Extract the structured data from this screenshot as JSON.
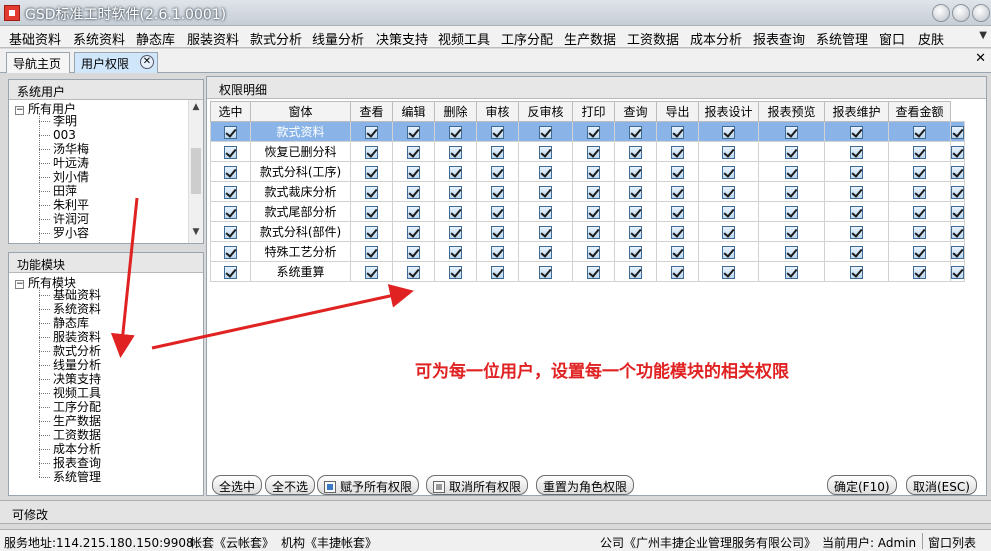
{
  "window": {
    "title": "GSD标准工时软件(2.6.1.0001)",
    "accent_color": "#e02222",
    "selection_color": "#8ab4e8"
  },
  "menu": [
    {
      "label": "基础资料"
    },
    {
      "label": "系统资料"
    },
    {
      "label": "静态库"
    },
    {
      "label": "服装资料"
    },
    {
      "label": "款式分析"
    },
    {
      "label": "线量分析"
    },
    {
      "label": "决策支持"
    },
    {
      "label": "视频工具"
    },
    {
      "label": "工序分配"
    },
    {
      "label": "生产数据"
    },
    {
      "label": "工资数据"
    },
    {
      "label": "成本分析"
    },
    {
      "label": "报表查询"
    },
    {
      "label": "系统管理"
    },
    {
      "label": "窗口"
    },
    {
      "label": "皮肤"
    }
  ],
  "tabs": {
    "home_label": "导航主页",
    "active_label": "用户权限"
  },
  "users_panel": {
    "header": "系统用户",
    "root": "所有用户",
    "users": [
      "李明",
      "003",
      "汤华梅",
      "叶远涛",
      "刘小倩",
      "田萍",
      "朱利平",
      "许润河",
      "罗小容"
    ]
  },
  "modules_panel": {
    "header": "功能模块",
    "root": "所有模块",
    "modules": [
      "基础资料",
      "系统资料",
      "静态库",
      "服装资料",
      "款式分析",
      "线量分析",
      "决策支持",
      "视频工具",
      "工序分配",
      "生产数据",
      "工资数据",
      "成本分析",
      "报表查询",
      "系统管理"
    ]
  },
  "permissions": {
    "header": "权限明细",
    "columns": [
      "选中",
      "窗体",
      "查看",
      "编辑",
      "删除",
      "审核",
      "反审核",
      "打印",
      "查询",
      "导出",
      "报表设计",
      "报表预览",
      "报表维护",
      "查看金额"
    ],
    "rows": [
      {
        "form": "款式资料",
        "selected": true,
        "checks": [
          true,
          true,
          true,
          true,
          true,
          true,
          true,
          true,
          true,
          true,
          true,
          true,
          true
        ]
      },
      {
        "form": "恢复已删分科",
        "selected": false,
        "checks": [
          true,
          true,
          true,
          true,
          true,
          true,
          true,
          true,
          true,
          true,
          true,
          true,
          true
        ]
      },
      {
        "form": "款式分科(工序)",
        "selected": false,
        "checks": [
          true,
          true,
          true,
          true,
          true,
          true,
          true,
          true,
          true,
          true,
          true,
          true,
          true
        ]
      },
      {
        "form": "款式裁床分析",
        "selected": false,
        "checks": [
          true,
          true,
          true,
          true,
          true,
          true,
          true,
          true,
          true,
          true,
          true,
          true,
          true
        ]
      },
      {
        "form": "款式尾部分析",
        "selected": false,
        "checks": [
          true,
          true,
          true,
          true,
          true,
          true,
          true,
          true,
          true,
          true,
          true,
          true,
          true
        ]
      },
      {
        "form": "款式分科(部件)",
        "selected": false,
        "checks": [
          true,
          true,
          true,
          true,
          true,
          true,
          true,
          true,
          true,
          true,
          true,
          true,
          true
        ]
      },
      {
        "form": "特殊工艺分析",
        "selected": false,
        "checks": [
          true,
          true,
          true,
          true,
          true,
          true,
          true,
          true,
          true,
          true,
          true,
          true,
          true
        ]
      },
      {
        "form": "系统重算",
        "selected": false,
        "checks": [
          true,
          true,
          true,
          true,
          true,
          true,
          true,
          true,
          true,
          true,
          true,
          true,
          true
        ]
      }
    ]
  },
  "annotation": "可为每一位用户，设置每一个功能模块的相关权限",
  "buttons": {
    "select_all": "全选中",
    "select_none": "全不选",
    "grant_all": "赋予所有权限",
    "revoke_all": "取消所有权限",
    "reset_role": "重置为角色权限",
    "ok": "确定(F10)",
    "cancel": "取消(ESC)"
  },
  "edit_status": "可修改",
  "statusbar": {
    "server": "服务地址:114.215.180.150:9908",
    "account": "帐套《云帐套》",
    "org": "机构《丰捷帐套》",
    "company": "公司《广州丰捷企业管理服务有限公司》",
    "current_user": "当前用户: Admin",
    "window_list": "窗口列表"
  }
}
